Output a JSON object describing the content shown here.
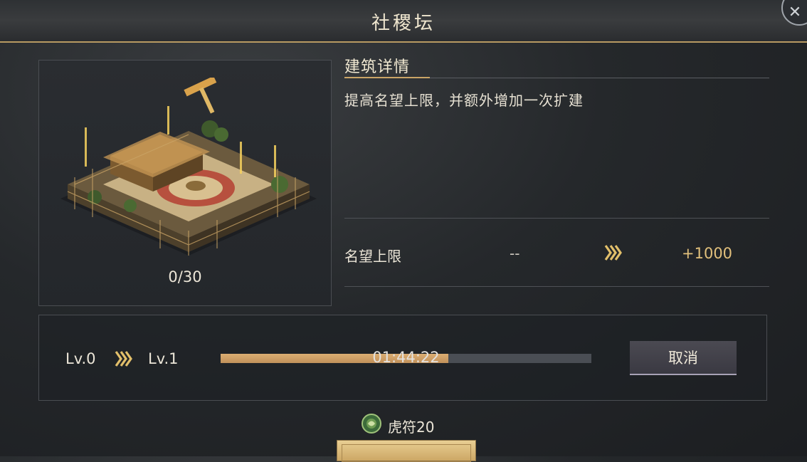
{
  "header": {
    "title": "社稷坛"
  },
  "building": {
    "progress": "0/30"
  },
  "details": {
    "title": "建筑详情",
    "description": "提高名望上限，并额外增加一次扩建",
    "stat": {
      "name": "名望上限",
      "current": "--",
      "next": "+1000"
    }
  },
  "upgrade": {
    "from": "Lv.0",
    "to": "Lv.1",
    "timer": "01:44:22",
    "progress_fraction": 0.615,
    "cancel_label": "取消"
  },
  "cost": {
    "label": "虎符20",
    "icon": "tiger-tally-icon"
  },
  "colors": {
    "accent_gold": "#caa466",
    "bar_fill": "#d2a46a",
    "value_gold": "#e2c07c"
  },
  "icons": {
    "close": "close-icon",
    "arrow": "triple-chevron-right-icon"
  }
}
